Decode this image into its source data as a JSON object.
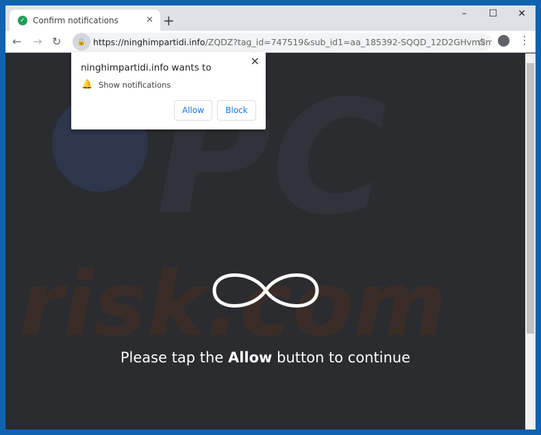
{
  "browser": {
    "tab_title": "Confirm notifications",
    "tab_icon": "check-circle-icon",
    "url_host": "https://ninghimpartidi.info",
    "url_rest": "/ZQDZ?tag_id=747519&sub_id1=aa_185392-SQQD_12D2GHvmSm1I3n..."
  },
  "popup": {
    "heading": "ninghimpartidi.info wants to",
    "permission": "Show notifications",
    "allow_label": "Allow",
    "block_label": "Block"
  },
  "page": {
    "msg_before": "Please tap the ",
    "msg_bold": "Allow",
    "msg_after": " button to continue",
    "watermark": "PC risk.com"
  },
  "colors": {
    "accent": "#1a73e8",
    "background": "#2a2c30",
    "frame": "#1063b1"
  }
}
